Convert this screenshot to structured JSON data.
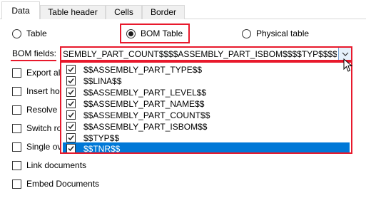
{
  "tabs": [
    {
      "label": "Data",
      "active": true
    },
    {
      "label": "Table header",
      "active": false
    },
    {
      "label": "Cells",
      "active": false
    },
    {
      "label": "Border",
      "active": false
    }
  ],
  "table_type": {
    "options": [
      {
        "label": "Table",
        "checked": false
      },
      {
        "label": "BOM Table",
        "checked": true
      },
      {
        "label": "Physical table",
        "checked": false
      }
    ]
  },
  "bom_fields": {
    "label": "BOM fields:",
    "value": "SEMBLY_PART_COUNT$$$$ASSEMBLY_PART_ISBOM$$$$TYP$$$$TNR$$",
    "items": [
      {
        "label": "$$ASSEMBLY_PART_TYPE$$",
        "checked": true,
        "selected": false
      },
      {
        "label": "$$LINA$$",
        "checked": true,
        "selected": false
      },
      {
        "label": "$$ASSEMBLY_PART_LEVEL$$",
        "checked": true,
        "selected": false
      },
      {
        "label": "$$ASSEMBLY_PART_NAME$$",
        "checked": true,
        "selected": false
      },
      {
        "label": "$$ASSEMBLY_PART_COUNT$$",
        "checked": true,
        "selected": false
      },
      {
        "label": "$$ASSEMBLY_PART_ISBOM$$",
        "checked": true,
        "selected": false
      },
      {
        "label": "$$TYP$$",
        "checked": true,
        "selected": false
      },
      {
        "label": "$$TNR$$",
        "checked": true,
        "selected": true
      }
    ]
  },
  "options": [
    {
      "label": "Export al",
      "checked": false
    },
    {
      "label": "Insert ho",
      "checked": false
    },
    {
      "label": "Resolve v",
      "checked": false
    },
    {
      "label": "Switch ro",
      "checked": false
    },
    {
      "label": "Single ov",
      "checked": false
    },
    {
      "label": "Link documents",
      "checked": false
    },
    {
      "label": "Embed Documents",
      "checked": false
    }
  ],
  "colors": {
    "highlight_red": "#e8192c",
    "selection_blue": "#0078d7"
  }
}
